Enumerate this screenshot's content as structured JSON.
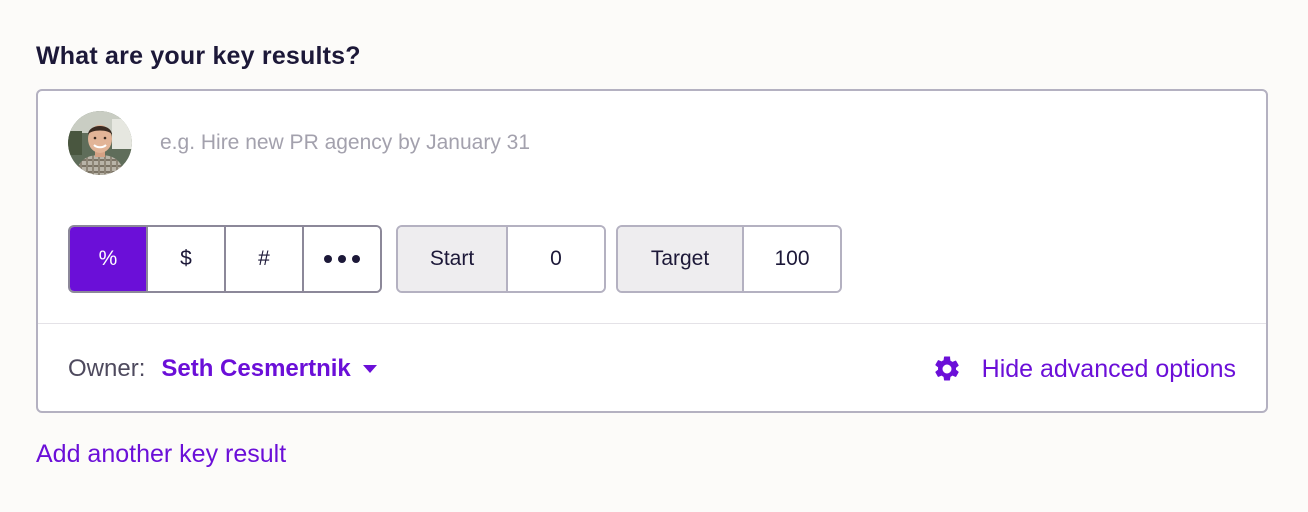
{
  "heading": "What are your key results?",
  "key_result": {
    "placeholder": "e.g. Hire new PR agency by January 31",
    "value": ""
  },
  "units": {
    "options": [
      {
        "label": "%",
        "icon": null,
        "selected": true
      },
      {
        "label": "$",
        "icon": null,
        "selected": false
      },
      {
        "label": "#",
        "icon": null,
        "selected": false
      },
      {
        "label": "",
        "icon": "more-dots-icon",
        "selected": false
      }
    ]
  },
  "start": {
    "label": "Start",
    "value": "0"
  },
  "target": {
    "label": "Target",
    "value": "100"
  },
  "owner": {
    "label": "Owner:",
    "name": "Seth Cesmertnik"
  },
  "advanced_options": {
    "label": "Hide advanced options",
    "icon": "gear-icon"
  },
  "add_another": "Add another key result",
  "colors": {
    "accent": "#6b0fd8",
    "heading_text": "#1c1838",
    "border": "#b4b1c1",
    "label_background": "#eeedef"
  }
}
